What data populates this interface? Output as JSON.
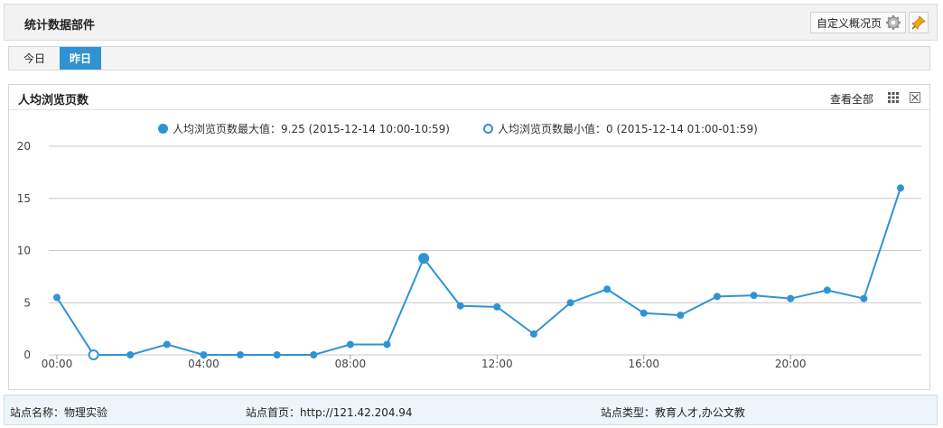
{
  "header": {
    "title": "统计数据部件",
    "custom_button_label": "自定义概况页"
  },
  "tabs": [
    {
      "label": "今日",
      "active": false
    },
    {
      "label": "昨日",
      "active": true
    }
  ],
  "panel": {
    "title": "人均浏览页数",
    "view_all_label": "查看全部"
  },
  "legend": {
    "max_label": "人均浏览页数最大值：9.25 (2015-12-14 10:00-10:59)",
    "min_label": "人均浏览页数最小值：0 (2015-12-14 01:00-01:59)"
  },
  "footer": {
    "site_name": "站点名称：物理实验",
    "site_home": "站点首页：http://121.42.204.94",
    "site_type": "站点类型：教育人才,办公文教"
  },
  "colors": {
    "accent": "#2f93d3",
    "grid": "#c8c8c8"
  },
  "chart_data": {
    "type": "line",
    "title": "",
    "xlabel": "",
    "ylabel": "",
    "ylim": [
      0,
      20
    ],
    "yticks": [
      0,
      5,
      10,
      15,
      20
    ],
    "x": [
      "00:00",
      "01:00",
      "02:00",
      "03:00",
      "04:00",
      "05:00",
      "06:00",
      "07:00",
      "08:00",
      "09:00",
      "10:00",
      "11:00",
      "12:00",
      "13:00",
      "14:00",
      "15:00",
      "16:00",
      "17:00",
      "18:00",
      "19:00",
      "20:00",
      "21:00",
      "22:00",
      "23:00"
    ],
    "xtick_labels": [
      "00:00",
      "04:00",
      "08:00",
      "12:00",
      "16:00",
      "20:00"
    ],
    "series": [
      {
        "name": "人均浏览页数",
        "values": [
          5.5,
          0,
          0,
          1,
          0,
          0,
          0,
          0,
          1,
          1,
          9.25,
          4.7,
          4.6,
          2,
          5,
          6.3,
          4,
          3.8,
          5.6,
          5.7,
          5.4,
          6.2,
          5.4,
          16
        ]
      }
    ],
    "max_index": 10,
    "min_index": 1,
    "grid": true,
    "legend_position": "top"
  }
}
